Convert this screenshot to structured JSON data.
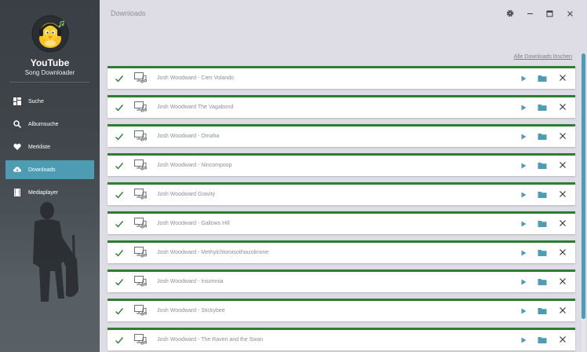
{
  "app": {
    "name": "YouTube",
    "subtitle": "Song Downloader"
  },
  "nav": [
    {
      "label": "Suche",
      "icon": "dashboard-icon",
      "active": false
    },
    {
      "label": "Albumsuche",
      "icon": "search-icon",
      "active": false
    },
    {
      "label": "Merkliste",
      "icon": "heart-icon",
      "active": false
    },
    {
      "label": "Downloads",
      "icon": "cloud-download-icon",
      "active": true
    },
    {
      "label": "Mediaplayer",
      "icon": "film-icon",
      "active": false
    }
  ],
  "header": {
    "title": "Downloads"
  },
  "toolbar": {
    "clear_all": "Alle Downloads löschen"
  },
  "downloads": [
    {
      "title": "Josh Woodward - Cien Volando"
    },
    {
      "title": "Josh Woodward The Vagabond"
    },
    {
      "title": "Josh Woodward - Omaha"
    },
    {
      "title": "Josh Woodward - Nincompoop"
    },
    {
      "title": "Josh Woodward Gravity"
    },
    {
      "title": "Josh Woodward - Gallows Hill"
    },
    {
      "title": "Josh Woodward - Methylchloroisothiazolinone"
    },
    {
      "title": "Josh Woodward - Insomnia"
    },
    {
      "title": "Josh Woodward - Stickybee"
    },
    {
      "title": "Josh Woodward - The Raven and the Swan"
    }
  ],
  "colors": {
    "accent": "#4d9cb3",
    "success": "#2f7d32",
    "sidebar": "#3e4449"
  }
}
